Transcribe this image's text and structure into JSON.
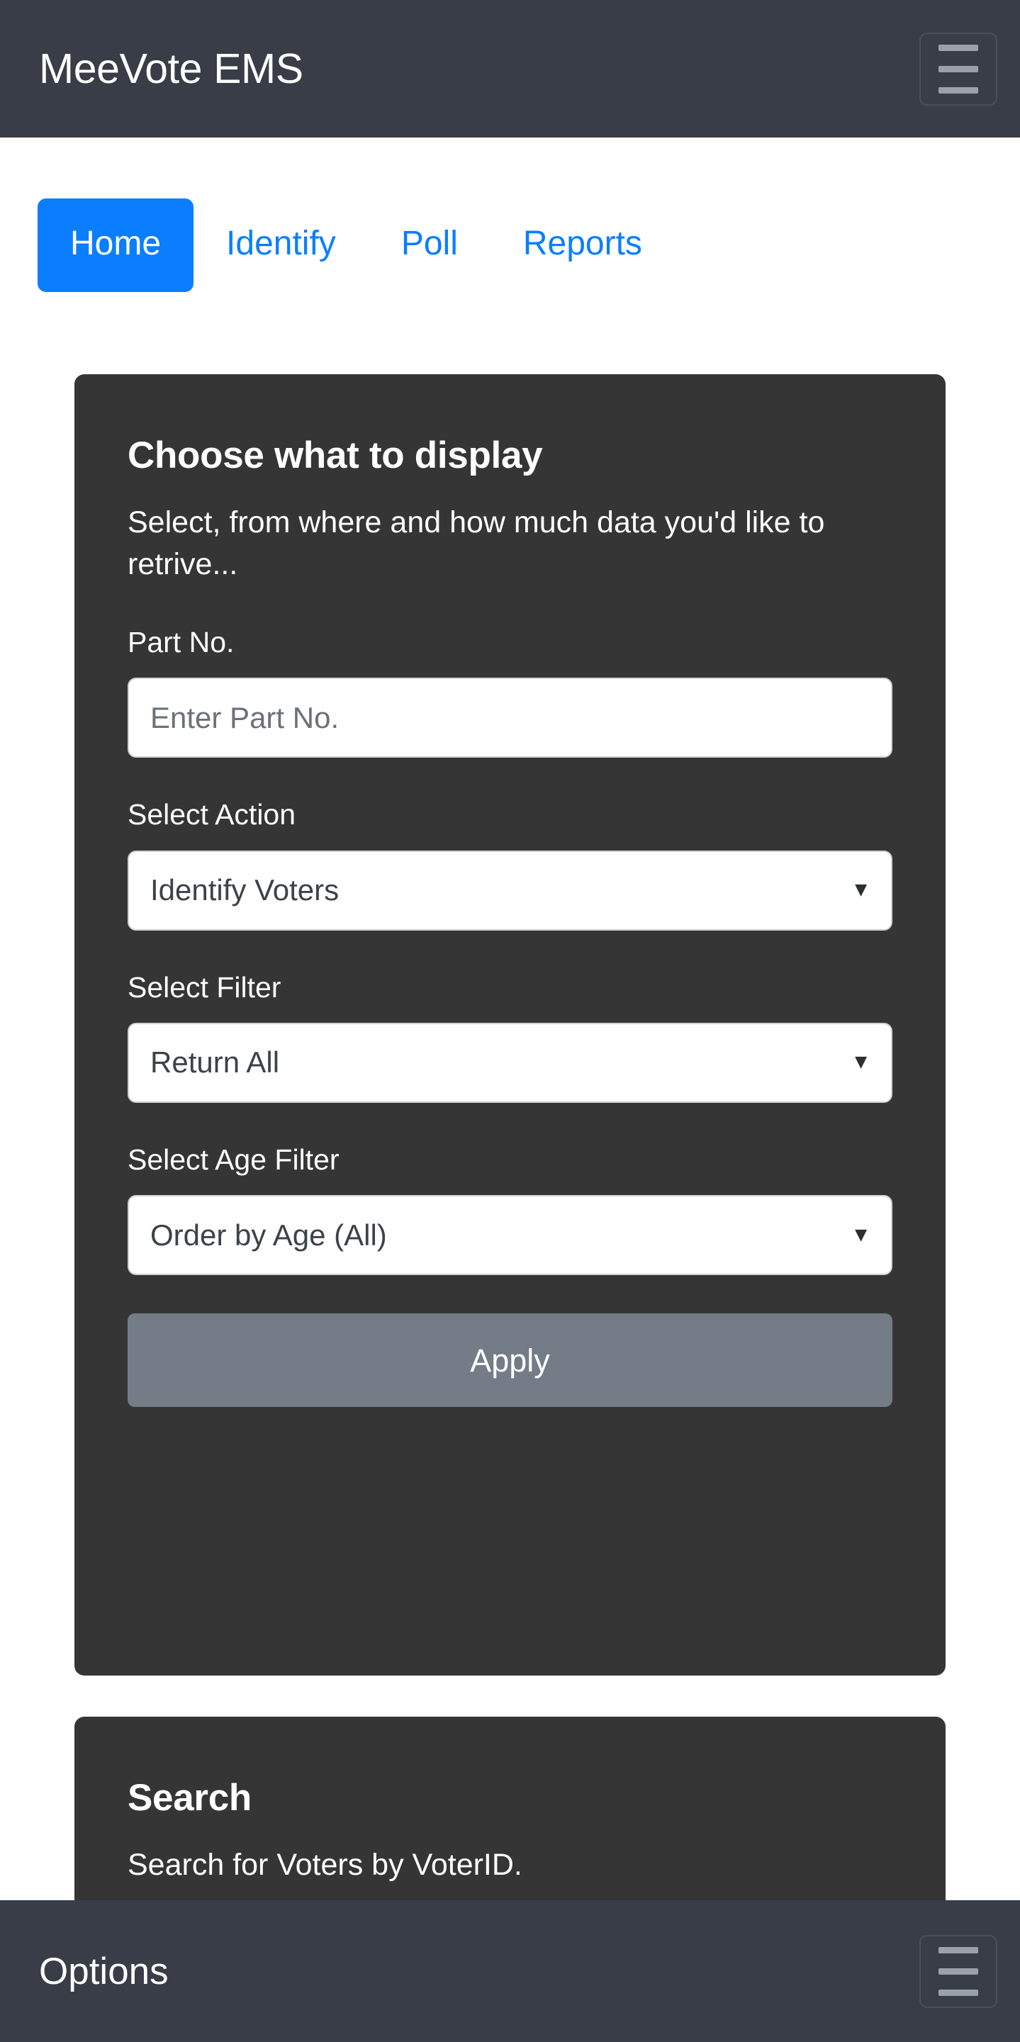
{
  "header": {
    "brand": "MeeVote EMS",
    "menu_icon": "hamburger-icon"
  },
  "tabs": [
    {
      "label": "Home",
      "active": true
    },
    {
      "label": "Identify",
      "active": false
    },
    {
      "label": "Poll",
      "active": false
    },
    {
      "label": "Reports",
      "active": false
    }
  ],
  "display_card": {
    "title": "Choose what to display",
    "subtitle": "Select, from where and how much data you'd like to retrive...",
    "part_no": {
      "label": "Part No.",
      "value": "",
      "placeholder": "Enter Part No."
    },
    "action": {
      "label": "Select Action",
      "selected": "Identify Voters"
    },
    "filter": {
      "label": "Select Filter",
      "selected": "Return All"
    },
    "age_filter": {
      "label": "Select Age Filter",
      "selected": "Order by Age (All)"
    },
    "apply_label": "Apply"
  },
  "search_card": {
    "title": "Search",
    "subtitle": "Search for Voters by VoterID."
  },
  "footer": {
    "title": "Options",
    "menu_icon": "hamburger-icon"
  },
  "colors": {
    "navbar": "#383d47",
    "card": "#353535",
    "accent": "#0b7eff",
    "apply_button": "#737c87",
    "page_background": "#ffffff",
    "input_background": "#ffffff",
    "input_border": "#ccd2d8"
  }
}
